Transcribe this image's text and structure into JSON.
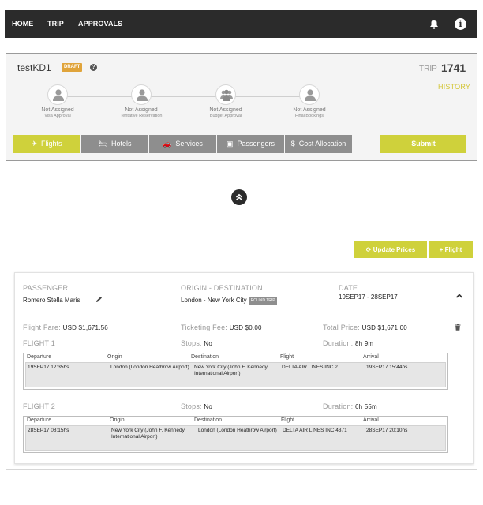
{
  "nav": {
    "items": [
      "HOME",
      "TRIP",
      "APPROVALS"
    ],
    "icons": [
      "bell-icon",
      "info-icon"
    ]
  },
  "trip": {
    "name": "testKD1",
    "status_badge": "DRAFT",
    "trip_label": "TRIP",
    "trip_number": "1741",
    "history_label": "HISTORY",
    "accent_color": "#cfd13b",
    "steps": [
      {
        "status": "Not Assigned",
        "label": "Visa Approval",
        "icon": "user-icon"
      },
      {
        "status": "Not Assigned",
        "label": "Tentative Reservation",
        "icon": "user-icon"
      },
      {
        "status": "Not Assigned",
        "label": "Budget Approval",
        "icon": "group-icon"
      },
      {
        "status": "Not Assigned",
        "label": "Final Bookings",
        "icon": "user-icon"
      }
    ],
    "tabs": [
      {
        "label": "Flights",
        "icon": "plane-icon",
        "active": true
      },
      {
        "label": "Hotels",
        "icon": "bed-icon",
        "active": false
      },
      {
        "label": "Services",
        "icon": "car-icon",
        "active": false
      },
      {
        "label": "Passengers",
        "icon": "luggage-icon",
        "active": false
      },
      {
        "label": "Cost Allocation",
        "icon": "dollar-icon",
        "active": false
      }
    ],
    "submit_label": "Submit"
  },
  "flights": {
    "update_prices_label": "Update Prices",
    "add_flight_label": "Flight",
    "booking": {
      "passenger_label": "PASSENGER",
      "passenger": "Romero Stella Maris",
      "od_label": "ORIGIN - DESTINATION",
      "od": "London - New York City",
      "trip_type": "ROUND TRIP",
      "date_label": "DATE",
      "date": "19SEP17 - 28SEP17",
      "fare_label": "Flight Fare:",
      "fare": "USD $1,671.56",
      "fee_label": "Ticketing Fee:",
      "fee": "USD $0.00",
      "total_label": "Total Price:",
      "total": "USD $1,671.00"
    },
    "segment_columns": [
      "Departure",
      "Origin",
      "Destination",
      "Flight",
      "Arrival"
    ],
    "segments": [
      {
        "title": "FLIGHT 1",
        "stops_label": "Stops:",
        "stops": "No",
        "duration_label": "Duration:",
        "duration": "8h 9m",
        "row": {
          "departure": "19SEP17 12:35hs",
          "origin": "London (London Heathrow Airport)",
          "destination": "New York City (John F. Kennedy International Airport)",
          "flight": "DELTA AIR LINES INC 2",
          "arrival": "19SEP17 15:44hs"
        }
      },
      {
        "title": "FLIGHT 2",
        "stops_label": "Stops:",
        "stops": "No",
        "duration_label": "Duration:",
        "duration": "6h 55m",
        "row": {
          "departure": "28SEP17 08:15hs",
          "origin": "New York City (John F. Kennedy International Airport)",
          "destination": "London (London Heathrow Airport)",
          "flight": "DELTA AIR LINES INC 4371",
          "arrival": "28SEP17 20:10hs"
        }
      }
    ]
  }
}
